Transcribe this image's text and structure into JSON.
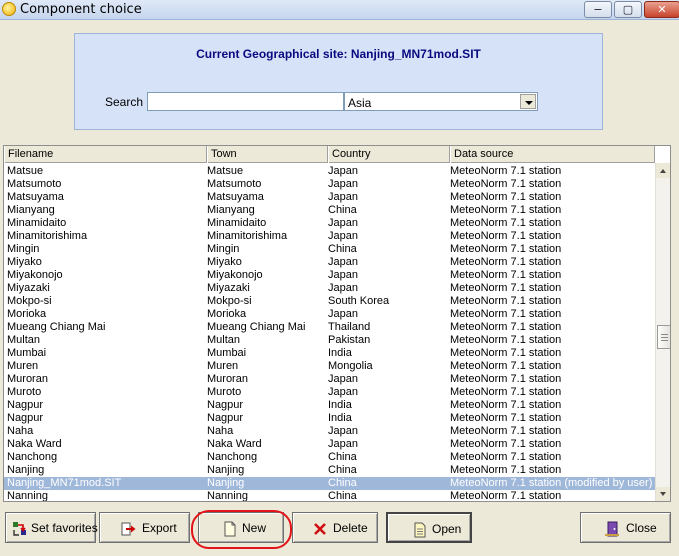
{
  "window": {
    "title": "Component choice",
    "controls": {
      "minimize": "−",
      "maximize": "▢",
      "close": "✕"
    }
  },
  "site": {
    "label": "Current Geographical site: Nanjing_MN71mod.SIT"
  },
  "search": {
    "label": "Search",
    "value": "",
    "placeholder": "",
    "region_selected": "Asia"
  },
  "table": {
    "columns": [
      "Filename",
      "Town",
      "Country",
      "Data source"
    ],
    "rows": [
      [
        "Matsue",
        "Matsue",
        "Japan",
        "MeteoNorm 7.1 station"
      ],
      [
        "Matsumoto",
        "Matsumoto",
        "Japan",
        "MeteoNorm 7.1 station"
      ],
      [
        "Matsuyama",
        "Matsuyama",
        "Japan",
        "MeteoNorm 7.1 station"
      ],
      [
        "Mianyang",
        "Mianyang",
        "China",
        "MeteoNorm 7.1 station"
      ],
      [
        "Minamidaito",
        "Minamidaito",
        "Japan",
        "MeteoNorm 7.1 station"
      ],
      [
        "Minamitorishima",
        "Minamitorishima",
        "Japan",
        "MeteoNorm 7.1 station"
      ],
      [
        "Mingin",
        "Mingin",
        "China",
        "MeteoNorm 7.1 station"
      ],
      [
        "Miyako",
        "Miyako",
        "Japan",
        "MeteoNorm 7.1 station"
      ],
      [
        "Miyakonojo",
        "Miyakonojo",
        "Japan",
        "MeteoNorm 7.1 station"
      ],
      [
        "Miyazaki",
        "Miyazaki",
        "Japan",
        "MeteoNorm 7.1 station"
      ],
      [
        "Mokpo-si",
        "Mokpo-si",
        "South Korea",
        "MeteoNorm 7.1 station"
      ],
      [
        "Morioka",
        "Morioka",
        "Japan",
        "MeteoNorm 7.1 station"
      ],
      [
        "Mueang Chiang Mai",
        "Mueang Chiang Mai",
        "Thailand",
        "MeteoNorm 7.1 station"
      ],
      [
        "Multan",
        "Multan",
        "Pakistan",
        "MeteoNorm 7.1 station"
      ],
      [
        "Mumbai",
        "Mumbai",
        "India",
        "MeteoNorm 7.1 station"
      ],
      [
        "Muren",
        "Muren",
        "Mongolia",
        "MeteoNorm 7.1 station"
      ],
      [
        "Muroran",
        "Muroran",
        "Japan",
        "MeteoNorm 7.1 station"
      ],
      [
        "Muroto",
        "Muroto",
        "Japan",
        "MeteoNorm 7.1 station"
      ],
      [
        "Nagpur",
        "Nagpur",
        "India",
        "MeteoNorm 7.1 station"
      ],
      [
        "Nagpur",
        "Nagpur",
        "India",
        "MeteoNorm 7.1 station"
      ],
      [
        "Naha",
        "Naha",
        "Japan",
        "MeteoNorm 7.1 station"
      ],
      [
        "Naka Ward",
        "Naka Ward",
        "Japan",
        "MeteoNorm 7.1 station"
      ],
      [
        "Nanchong",
        "Nanchong",
        "China",
        "MeteoNorm 7.1 station"
      ],
      [
        "Nanjing",
        "Nanjing",
        "China",
        "MeteoNorm 7.1 station"
      ],
      [
        "Nanjing_MN71mod.SIT",
        "Nanjing",
        "China",
        "MeteoNorm 7.1 station (modified by user)"
      ],
      [
        "Nanning",
        "Nanning",
        "China",
        "MeteoNorm 7.1 station"
      ]
    ],
    "selected_row": 24
  },
  "buttons": {
    "favorites": "Set favorites",
    "export": "Export",
    "new": "New",
    "delete": "Delete",
    "open": "Open",
    "close": "Close"
  },
  "icons": {
    "favorites": "favorites-icon",
    "export": "export-arrow-icon",
    "new": "new-document-icon",
    "delete": "delete-x-icon",
    "open": "open-document-icon",
    "close": "exit-door-icon"
  },
  "colors": {
    "selection": "#9fb7d9",
    "site_label": "#0a0a80",
    "annotation_ring": "#e2141a"
  }
}
